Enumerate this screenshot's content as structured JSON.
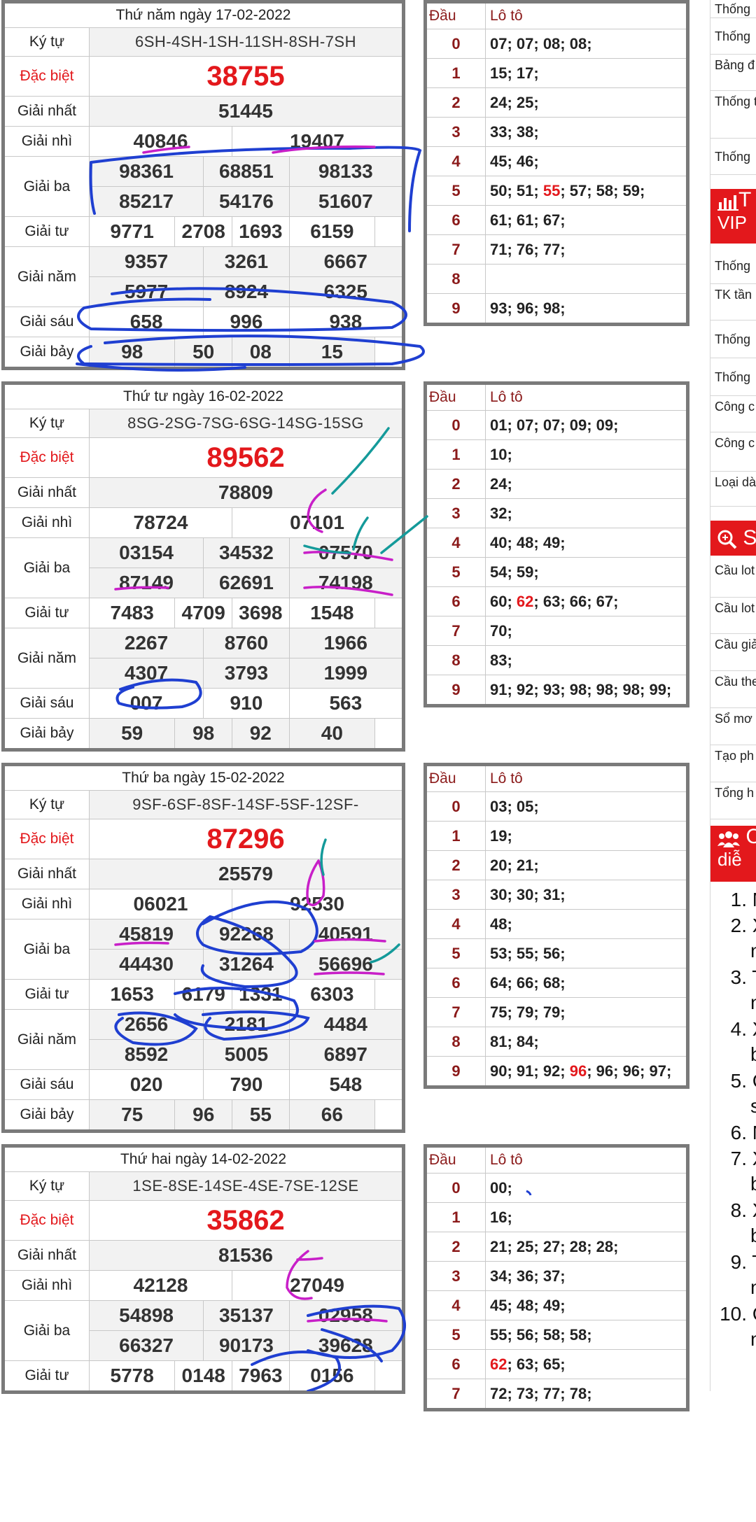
{
  "labels": {
    "symbol": "Ký tự",
    "special": "Đặc biệt",
    "first": "Giải nhất",
    "second": "Giải nhì",
    "third": "Giải ba",
    "fourth": "Giải tư",
    "fifth": "Giải năm",
    "sixth": "Giải sáu",
    "seventh": "Giải bảy",
    "dau": "Đầu",
    "loto": "Lô tô"
  },
  "draws": [
    {
      "date": "Thứ năm ngày 17-02-2022",
      "symbols": "6SH-4SH-1SH-11SH-8SH-7SH",
      "special": "38755",
      "first": "51445",
      "second": [
        "40846",
        "19407"
      ],
      "third": [
        "98361",
        "68851",
        "98133",
        "85217",
        "54176",
        "51607"
      ],
      "fourth": [
        "9771",
        "2708",
        "1693",
        "6159"
      ],
      "fifth": [
        "9357",
        "3261",
        "6667",
        "5977",
        "8924",
        "6325"
      ],
      "sixth": [
        "658",
        "996",
        "938"
      ],
      "seventh": [
        "98",
        "50",
        "08",
        "15"
      ],
      "loto": [
        {
          "dau": "0",
          "parts": [
            "07; 07; 08; 08;"
          ]
        },
        {
          "dau": "1",
          "parts": [
            "15; 17;"
          ]
        },
        {
          "dau": "2",
          "parts": [
            "24; 25;"
          ]
        },
        {
          "dau": "3",
          "parts": [
            "33; 38;"
          ]
        },
        {
          "dau": "4",
          "parts": [
            "45; 46;"
          ]
        },
        {
          "dau": "5",
          "parts": [
            "50; 51; ",
            "55",
            "; 57; 58; 59;"
          ]
        },
        {
          "dau": "6",
          "parts": [
            "61; 61; 67;"
          ]
        },
        {
          "dau": "7",
          "parts": [
            "71; 76; 77;"
          ]
        },
        {
          "dau": "8",
          "parts": [
            ""
          ]
        },
        {
          "dau": "9",
          "parts": [
            "93; 96; 98;"
          ]
        }
      ]
    },
    {
      "date": "Thứ tư ngày 16-02-2022",
      "symbols": "8SG-2SG-7SG-6SG-14SG-15SG",
      "special": "89562",
      "first": "78809",
      "second": [
        "78724",
        "07101"
      ],
      "third": [
        "03154",
        "34532",
        "07570",
        "87149",
        "62691",
        "74198"
      ],
      "fourth": [
        "7483",
        "4709",
        "3698",
        "1548"
      ],
      "fifth": [
        "2267",
        "8760",
        "1966",
        "4307",
        "3793",
        "1999"
      ],
      "sixth": [
        "007",
        "910",
        "563"
      ],
      "seventh": [
        "59",
        "98",
        "92",
        "40"
      ],
      "loto": [
        {
          "dau": "0",
          "parts": [
            "01; 07; 07; 09; 09;"
          ]
        },
        {
          "dau": "1",
          "parts": [
            "10;"
          ]
        },
        {
          "dau": "2",
          "parts": [
            "24;"
          ]
        },
        {
          "dau": "3",
          "parts": [
            "32;"
          ]
        },
        {
          "dau": "4",
          "parts": [
            "40; 48; 49;"
          ]
        },
        {
          "dau": "5",
          "parts": [
            "54; 59;"
          ]
        },
        {
          "dau": "6",
          "parts": [
            "60; ",
            "62",
            "; 63; 66; 67;"
          ]
        },
        {
          "dau": "7",
          "parts": [
            "70;"
          ]
        },
        {
          "dau": "8",
          "parts": [
            "83;"
          ]
        },
        {
          "dau": "9",
          "parts": [
            "91; 92; 93; 98; 98; 98; 99;"
          ]
        }
      ]
    },
    {
      "date": "Thứ ba ngày 15-02-2022",
      "symbols": "9SF-6SF-8SF-14SF-5SF-12SF-",
      "special": "87296",
      "first": "25579",
      "second": [
        "06021",
        "92530"
      ],
      "third": [
        "45819",
        "92268",
        "40591",
        "44430",
        "31264",
        "56696"
      ],
      "fourth": [
        "1653",
        "6179",
        "1331",
        "6303"
      ],
      "fifth": [
        "2656",
        "2181",
        "4484",
        "8592",
        "5005",
        "6897"
      ],
      "sixth": [
        "020",
        "790",
        "548"
      ],
      "seventh": [
        "75",
        "96",
        "55",
        "66"
      ],
      "loto": [
        {
          "dau": "0",
          "parts": [
            "03; 05;"
          ]
        },
        {
          "dau": "1",
          "parts": [
            "19;"
          ]
        },
        {
          "dau": "2",
          "parts": [
            "20; 21;"
          ]
        },
        {
          "dau": "3",
          "parts": [
            "30; 30; 31;"
          ]
        },
        {
          "dau": "4",
          "parts": [
            "48;"
          ]
        },
        {
          "dau": "5",
          "parts": [
            "53; 55; 56;"
          ]
        },
        {
          "dau": "6",
          "parts": [
            "64; 66; 68;"
          ]
        },
        {
          "dau": "7",
          "parts": [
            "75; 79; 79;"
          ]
        },
        {
          "dau": "8",
          "parts": [
            "81; 84;"
          ]
        },
        {
          "dau": "9",
          "parts": [
            "90; 91; 92; ",
            "96",
            "; 96; 96; 97;"
          ]
        }
      ]
    },
    {
      "date": "Thứ hai ngày 14-02-2022",
      "symbols": "1SE-8SE-14SE-4SE-7SE-12SE",
      "special": "35862",
      "first": "81536",
      "second": [
        "42128",
        "27049"
      ],
      "third": [
        "54898",
        "35137",
        "02958",
        "66327",
        "90173",
        "39628"
      ],
      "fourth": [
        "5778",
        "0148",
        "7963",
        "0156"
      ],
      "loto": [
        {
          "dau": "0",
          "parts": [
            "00;"
          ]
        },
        {
          "dau": "1",
          "parts": [
            "16;"
          ]
        },
        {
          "dau": "2",
          "parts": [
            "21; 25; 27; 28; 28;"
          ]
        },
        {
          "dau": "3",
          "parts": [
            "34; 36; 37;"
          ]
        },
        {
          "dau": "4",
          "parts": [
            "45; 48; 49;"
          ]
        },
        {
          "dau": "5",
          "parts": [
            "55; 56; 58; 58;"
          ]
        },
        {
          "dau": "6",
          "parts": [
            "",
            "62",
            "; 63; 65;"
          ]
        },
        {
          "dau": "7",
          "parts": [
            "72; 73; 77; 78;"
          ]
        }
      ]
    }
  ],
  "sidebar": {
    "items_top": [
      "Thống",
      "Thống",
      "Bảng đ",
      "Thống theo Đ",
      "Thống"
    ],
    "vip_header": "VIP",
    "items_vip": [
      "Thống",
      "TK tần",
      "Thống",
      "Thống",
      "Công c",
      "Công c VIP",
      "Loại dà"
    ],
    "items_soi": [
      "Cầu lot",
      "Cầu lot",
      "Cầu giả",
      "Cầu the",
      "Sổ mơ",
      "Tạo ph",
      "Tổng h"
    ],
    "forum_header": "diễ",
    "forum_list": [
      {
        "n": "1.",
        "t": "Mơ",
        "t2": ""
      },
      {
        "n": "2.",
        "t": "Xs",
        "t2": "nin"
      },
      {
        "n": "3.",
        "t": "Th",
        "t2": "ng"
      },
      {
        "n": "4.",
        "t": "Xs",
        "t2": "bìn"
      },
      {
        "n": "5.",
        "t": "Cầ",
        "t2": "sá"
      },
      {
        "n": "6.",
        "t": "Mơ",
        "t2": ""
      },
      {
        "n": "7.",
        "t": "Xs",
        "t2": "bìn"
      },
      {
        "n": "8.",
        "t": "Xs",
        "t2": "bìn"
      },
      {
        "n": "9.",
        "t": "Th",
        "t2": "ng"
      },
      {
        "n": "10.",
        "t": "Cầ",
        "t2": "nă"
      }
    ]
  },
  "colors": {
    "red": "#e3181c",
    "border": "#7a7a7a",
    "dau": "#8b1a1a",
    "pen_blue": "#1f3fd1",
    "pen_magenta": "#c81fc8",
    "pen_teal": "#149a9a"
  }
}
